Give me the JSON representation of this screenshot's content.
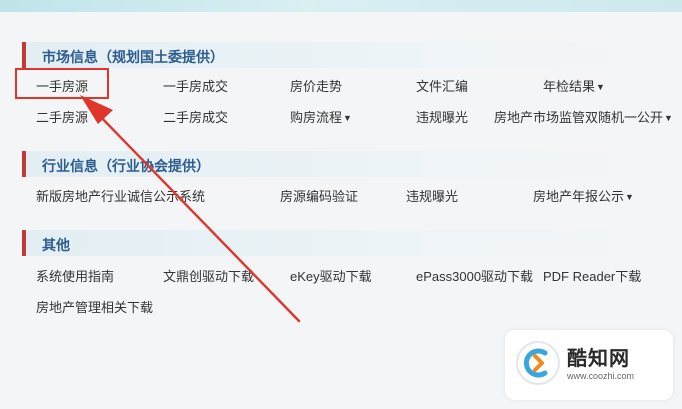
{
  "sections": [
    {
      "title": "市场信息（规划国土委提供）",
      "rows": [
        [
          {
            "label": "一手房源",
            "caret": ""
          },
          {
            "label": "一手房成交",
            "caret": ""
          },
          {
            "label": "房价走势",
            "caret": ""
          },
          {
            "label": "文件汇编",
            "caret": ""
          },
          {
            "label": "年检结果",
            "caret": "▼"
          }
        ],
        [
          {
            "label": "二手房源",
            "caret": ""
          },
          {
            "label": "二手房成交",
            "caret": ""
          },
          {
            "label": "购房流程",
            "caret": "▼"
          },
          {
            "label": "违规曝光",
            "caret": ""
          },
          {
            "label": "房地产市场监管双随机一公开",
            "caret": "▼"
          }
        ]
      ]
    },
    {
      "title": "行业信息（行业协会提供）",
      "rows": [
        [
          {
            "label": "新版房地产行业诚信公示系统",
            "caret": ""
          },
          {
            "label": "房源编码验证",
            "caret": ""
          },
          {
            "label": "违规曝光",
            "caret": ""
          },
          {
            "label": "房地产年报公示",
            "caret": "▼"
          }
        ]
      ]
    },
    {
      "title": "其他",
      "rows": [
        [
          {
            "label": "系统使用指南",
            "caret": ""
          },
          {
            "label": "文鼎创驱动下载",
            "caret": ""
          },
          {
            "label": "eKey驱动下载",
            "caret": ""
          },
          {
            "label": "ePass3000驱动下载",
            "caret": ""
          },
          {
            "label": "PDF Reader下载",
            "caret": ""
          }
        ],
        [
          {
            "label": "房地产管理相关下载",
            "caret": ""
          }
        ]
      ]
    }
  ],
  "watermark": {
    "name": "酷知网",
    "url": "www.coozhi.com"
  },
  "annotation_color": "#e0352b"
}
